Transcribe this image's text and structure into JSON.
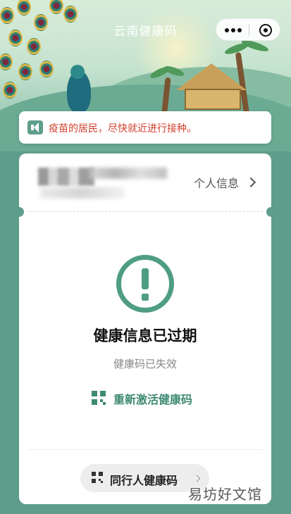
{
  "header": {
    "title": "云南健康码"
  },
  "notice": {
    "text": "疫苗的居民，尽快就近进行接种。"
  },
  "card": {
    "personal_info_label": "个人信息",
    "status_title": "健康信息已过期",
    "status_subtitle": "健康码已失效",
    "reactivate_label": "重新激活健康码",
    "companion_label": "同行人健康码"
  },
  "watermark": "易坊好文馆",
  "colors": {
    "primary": "#5e9d8b",
    "accent_green": "#4e9d84",
    "notice_red": "#d3402e"
  }
}
